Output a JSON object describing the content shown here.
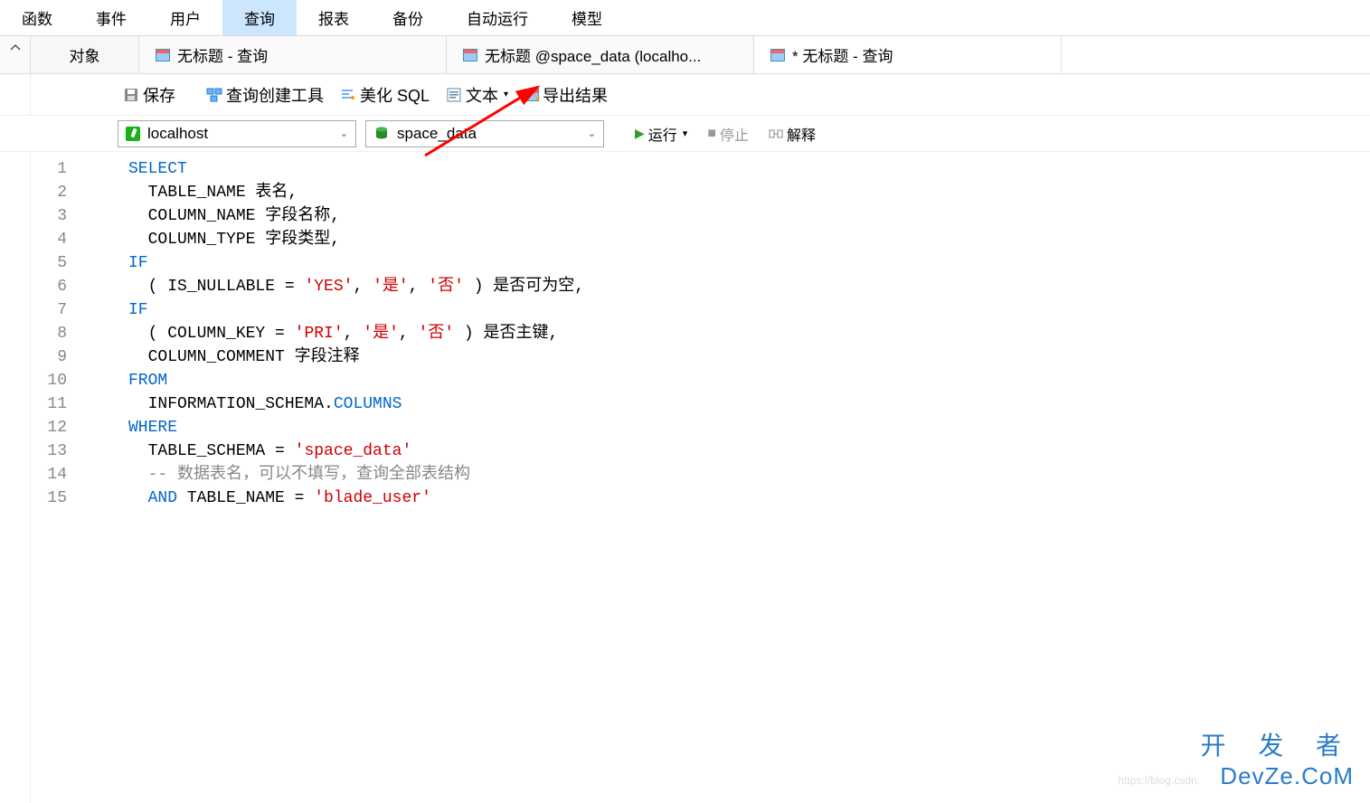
{
  "menu": {
    "items": [
      "函数",
      "事件",
      "用户",
      "查询",
      "报表",
      "备份",
      "自动运行",
      "模型"
    ],
    "active_index": 3
  },
  "tabs": {
    "objects_label": "对象",
    "items": [
      {
        "label": "无标题 - 查询"
      },
      {
        "label": "无标题 @space_data (localho..."
      },
      {
        "label": "* 无标题 - 查询"
      }
    ]
  },
  "toolbar": {
    "save": "保存",
    "query_builder": "查询创建工具",
    "beautify": "美化 SQL",
    "text": "文本",
    "export": "导出结果"
  },
  "connection": {
    "host": "localhost",
    "database": "space_data",
    "run": "运行",
    "stop": "停止",
    "explain": "解释"
  },
  "sql": {
    "line_count": 15,
    "tokens": [
      [
        {
          "t": "SELECT",
          "c": "kw"
        }
      ],
      [
        {
          "t": "  TABLE_NAME 表名,",
          "c": ""
        }
      ],
      [
        {
          "t": "  COLUMN_NAME 字段名称,",
          "c": ""
        }
      ],
      [
        {
          "t": "  COLUMN_TYPE 字段类型,",
          "c": ""
        }
      ],
      [
        {
          "t": "IF",
          "c": "kw"
        }
      ],
      [
        {
          "t": "  ( IS_NULLABLE = ",
          "c": ""
        },
        {
          "t": "'YES'",
          "c": "str"
        },
        {
          "t": ", ",
          "c": ""
        },
        {
          "t": "'是'",
          "c": "str"
        },
        {
          "t": ", ",
          "c": ""
        },
        {
          "t": "'否'",
          "c": "str"
        },
        {
          "t": " ) 是否可为空,",
          "c": ""
        }
      ],
      [
        {
          "t": "IF",
          "c": "kw"
        }
      ],
      [
        {
          "t": "  ( COLUMN_KEY = ",
          "c": ""
        },
        {
          "t": "'PRI'",
          "c": "str"
        },
        {
          "t": ", ",
          "c": ""
        },
        {
          "t": "'是'",
          "c": "str"
        },
        {
          "t": ", ",
          "c": ""
        },
        {
          "t": "'否'",
          "c": "str"
        },
        {
          "t": " ) 是否主键,",
          "c": ""
        }
      ],
      [
        {
          "t": "  COLUMN_COMMENT 字段注释",
          "c": ""
        }
      ],
      [
        {
          "t": "FROM",
          "c": "kw"
        }
      ],
      [
        {
          "t": "  INFORMATION_SCHEMA.",
          "c": ""
        },
        {
          "t": "COLUMNS",
          "c": "kw"
        }
      ],
      [
        {
          "t": "WHERE",
          "c": "kw"
        }
      ],
      [
        {
          "t": "  TABLE_SCHEMA = ",
          "c": ""
        },
        {
          "t": "'space_data'",
          "c": "str"
        }
      ],
      [
        {
          "t": "  -- 数据表名，可以不填写，查询全部表结构",
          "c": "cmt"
        }
      ],
      [
        {
          "t": "  ",
          "c": ""
        },
        {
          "t": "AND",
          "c": "kw"
        },
        {
          "t": " TABLE_NAME = ",
          "c": ""
        },
        {
          "t": "'blade_user'",
          "c": "str"
        }
      ]
    ]
  },
  "watermark": {
    "chinese": "开 发 者",
    "latin": "DevZe.CoM",
    "csdn": "https://blog.csdn."
  }
}
